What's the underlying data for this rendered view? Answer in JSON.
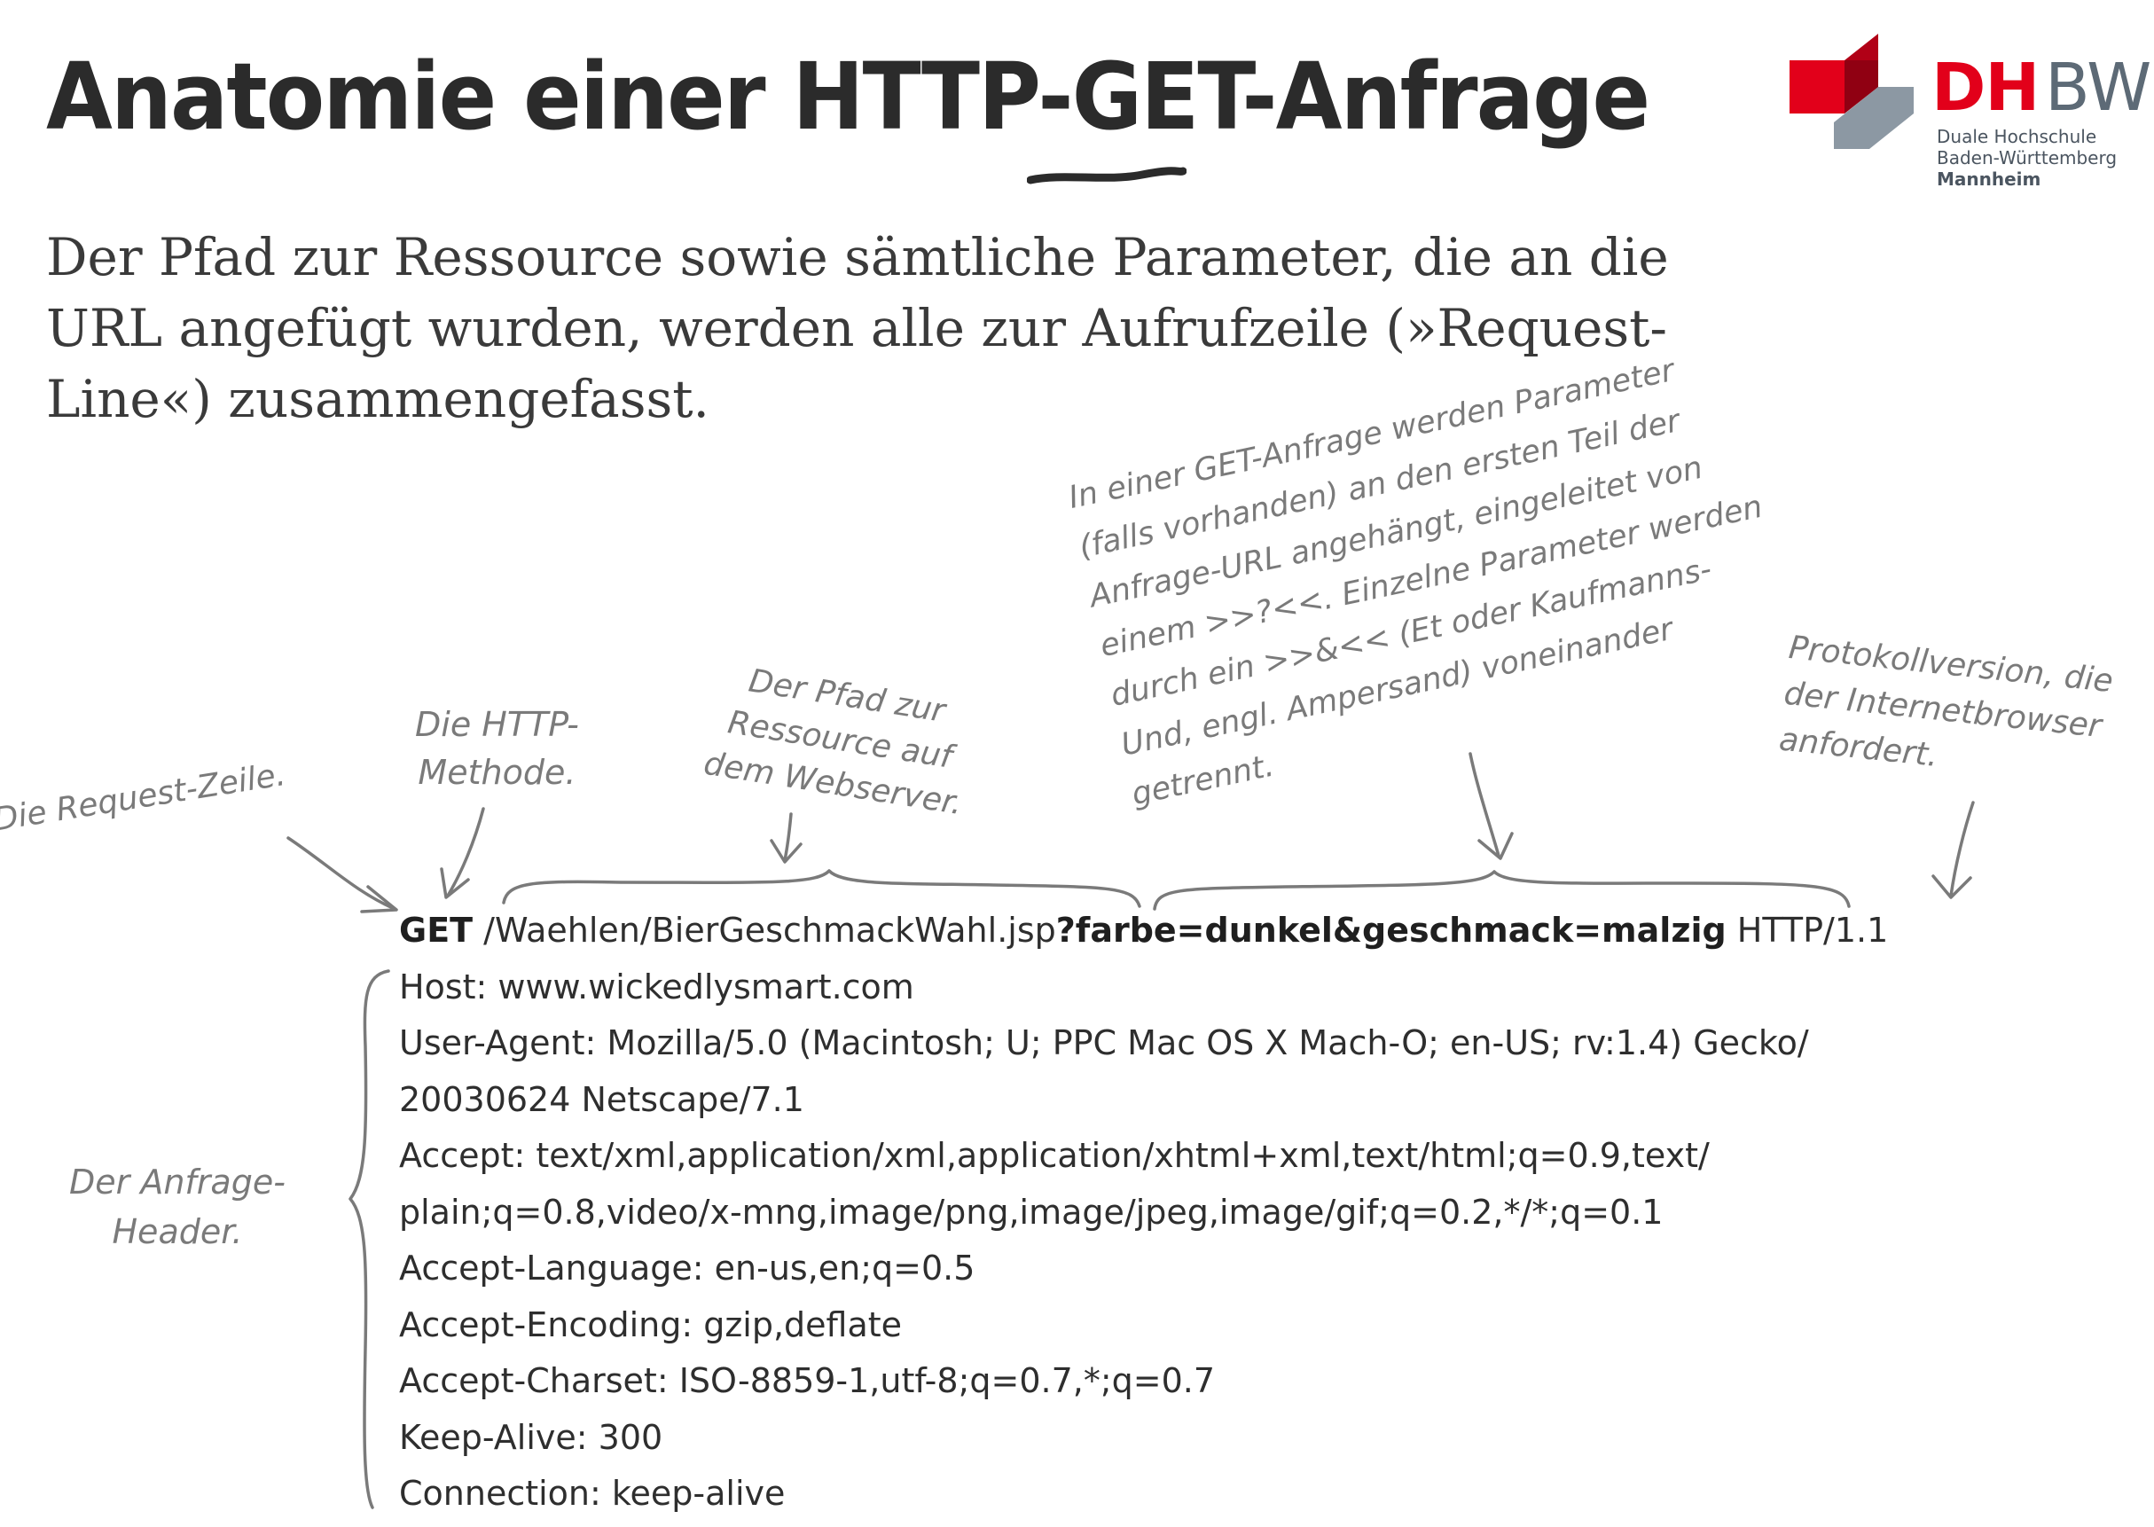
{
  "title": {
    "text": "Anatomie einer HTTP-GET-Anfrage"
  },
  "intro": {
    "lines": [
      "Der Pfad zur Ressource sowie sämtliche Parameter, die an die",
      "URL angefügt wurden, werden alle zur Aufrufzeile (»Request-",
      "Line«) zusammengefasst."
    ]
  },
  "logo": {
    "dh": "DH",
    "bw": "BW",
    "line1": "Duale Hochschule",
    "line2": "Baden-Württemberg",
    "campus": "Mannheim",
    "colors": {
      "red": "#e2001a",
      "grey": "#5d6a76"
    }
  },
  "annotations": {
    "request_line": "Die Request-Zeile.",
    "method": [
      "Die HTTP-",
      "Methode."
    ],
    "path": [
      "Der Pfad zur",
      "Ressource auf",
      "dem Webserver."
    ],
    "get_params": [
      "In einer GET-Anfrage werden Parameter",
      "(falls vorhanden) an den ersten Teil der",
      "Anfrage-URL angehängt, eingeleitet von",
      "einem >>?<<. Einzelne Parameter werden",
      "durch ein >>&<< (Et oder Kaufmanns-",
      "Und, engl. Ampersand) voneinander",
      "getrennt."
    ],
    "protocol": [
      "Protokollversion, die",
      "der Internetbrowser",
      "anfordert."
    ],
    "header": [
      "Der Anfrage-",
      "Header."
    ]
  },
  "request": {
    "method": "GET",
    "path": "/Waehlen/BierGeschmackWahl.jsp",
    "params": "?farbe=dunkel&geschmack=malzig",
    "protocol": "HTTP/1.1",
    "headers": [
      "Host: www.wickedlysmart.com",
      "User-Agent: Mozilla/5.0 (Macintosh; U; PPC Mac OS X Mach-O; en-US; rv:1.4) Gecko/",
      "20030624 Netscape/7.1",
      "Accept: text/xml,application/xml,application/xhtml+xml,text/html;q=0.9,text/",
      "plain;q=0.8,video/x-mng,image/png,image/jpeg,image/gif;q=0.2,*/*;q=0.1",
      "Accept-Language: en-us,en;q=0.5",
      "Accept-Encoding: gzip,deflate",
      "Accept-Charset: ISO-8859-1,utf-8;q=0.7,*;q=0.7",
      "Keep-Alive: 300",
      "Connection: keep-alive"
    ]
  }
}
